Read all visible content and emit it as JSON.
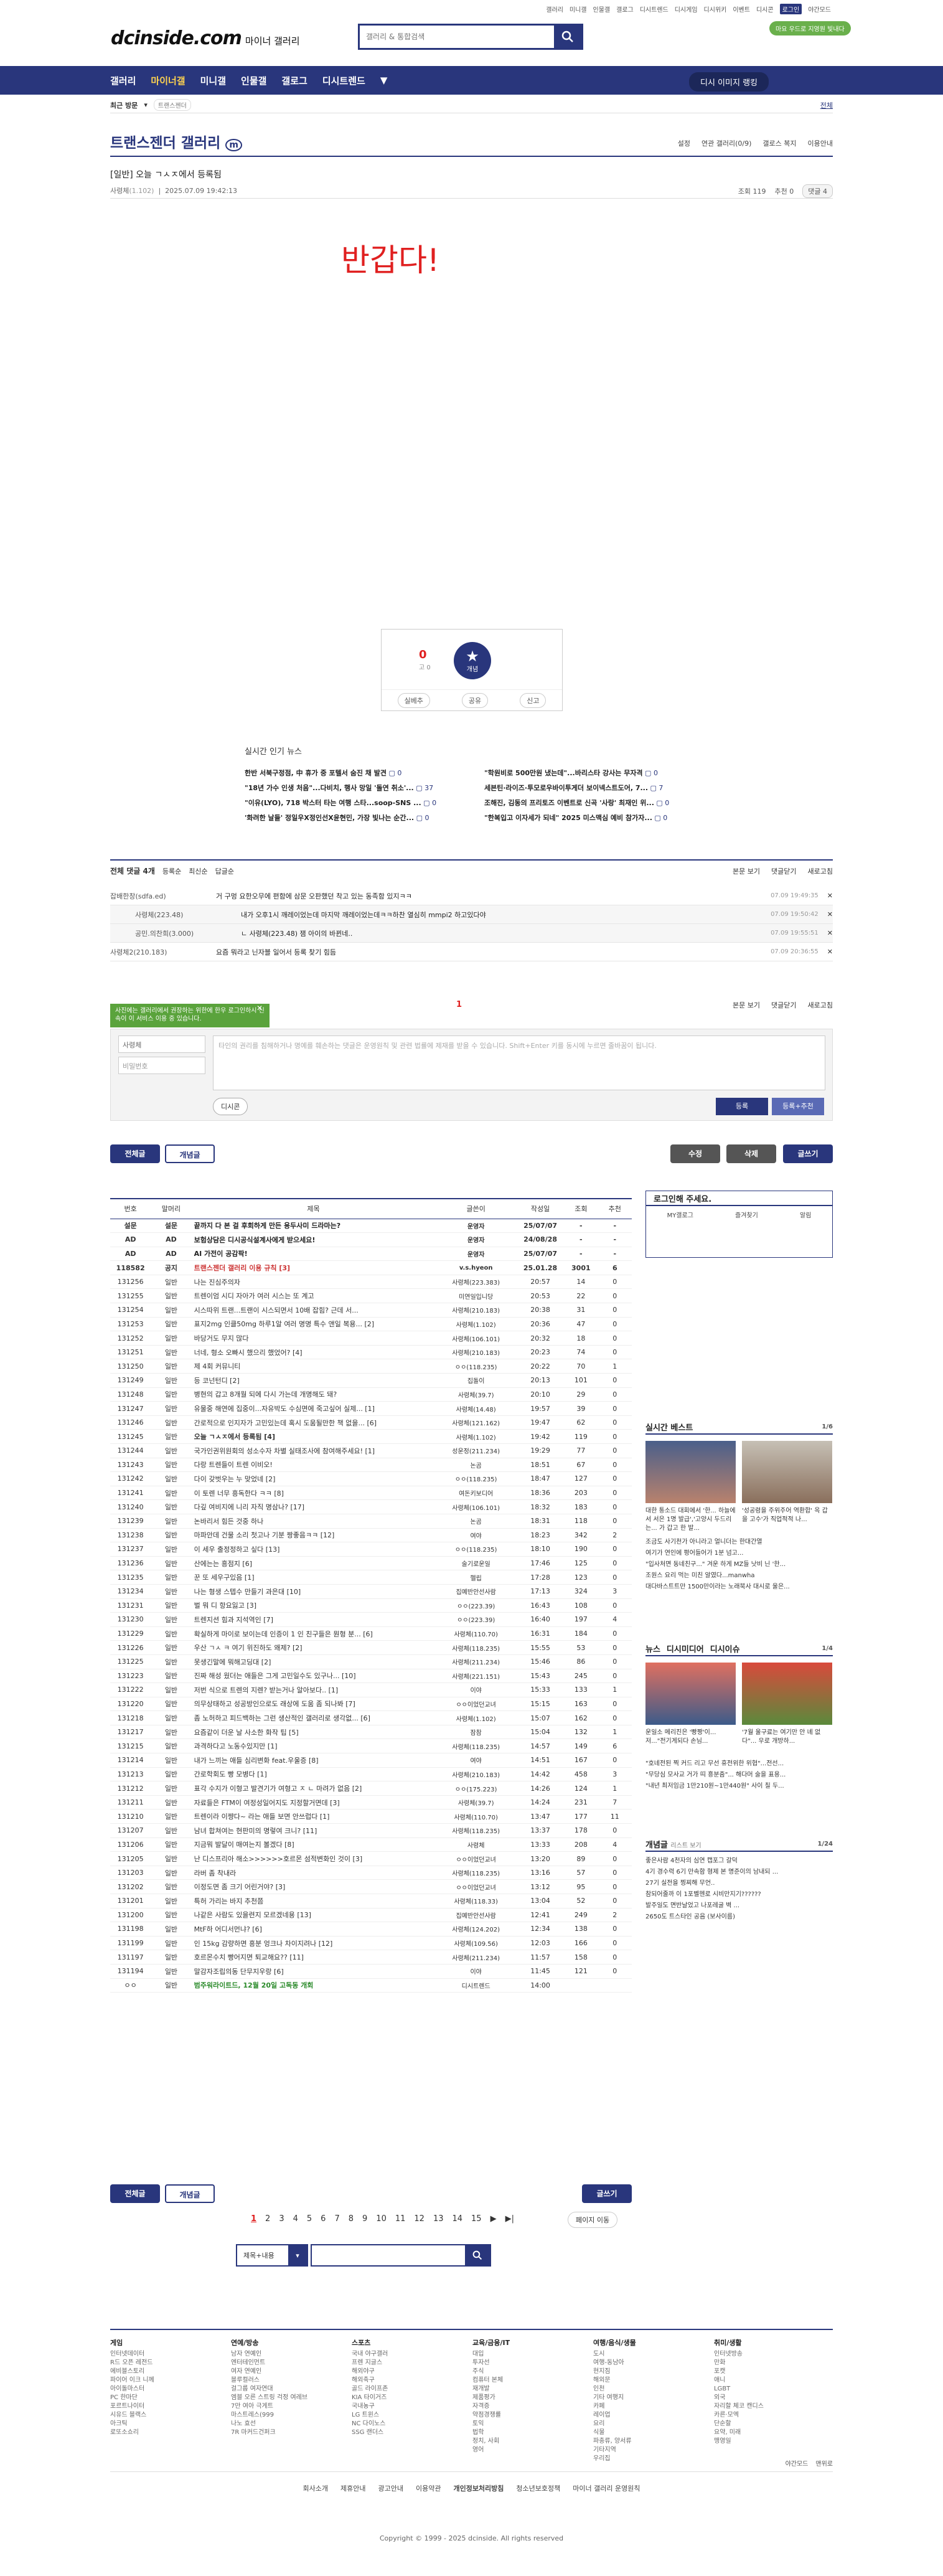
{
  "top_links": [
    "갤러리",
    "미니갤",
    "인물갤",
    "갤로그",
    "디시트렌드",
    "디시게임",
    "디시위키",
    "이벤트",
    "디시콘",
    "로그인",
    "야간모드"
  ],
  "logo": {
    "main": "dcinside.com",
    "sub": "마이너 갤러리"
  },
  "search": {
    "placeholder": "갤러리 & 통합검색"
  },
  "green_badge": "마요 우드로 지영원 빛내다",
  "gnb": {
    "items": [
      "갤러리",
      "마이너갤",
      "미니갤",
      "인물갤",
      "갤로그",
      "디시트렌드"
    ],
    "right": "디시 이미지 랭킹"
  },
  "sub_nav": {
    "recent": "최근 방문",
    "gallery": "트랜스젠더",
    "all": "전체"
  },
  "gallery_title": "트랜스젠더 갤러리",
  "gallery_opts": [
    "설정",
    "연관 갤러리(0/9)",
    "갤로스 복지",
    "이용안내"
  ],
  "post": {
    "title": "[일반] 오늘 ㄱㅅㅈ에서 등록됨",
    "author": "사령체",
    "ip": "(1.102)",
    "date": "2025.07.09 19:42:13",
    "views": "조회 119",
    "recs": "추천 0",
    "comments": "댓글 4",
    "body": "반갑다!"
  },
  "recommend": {
    "count": "0",
    "fixed": "0",
    "star": "개념",
    "acts": [
      "실베추",
      "공유",
      "신고"
    ]
  },
  "news": {
    "title": "실시간 인기 뉴스",
    "rows": [
      [
        "한반 서북구정점, 中 휴가 중 포텔서 숨진 채 발견",
        "\"학원비로 500만원 냈는데\"...바리스타 강사는 무자격"
      ],
      [
        "\"18년 가수 인생 처음\"...다비치, 행사 망일 '돌연 취소'...",
        "세븐틴·라이즈·투모로우바이투게더 보이넥스트도어, 7..."
      ],
      [
        "\"이유(LYO), 718 박스터 타는 여행 스타...soop-SNS ...",
        "조해진, 김동의 프리토즈 이벤트로 신곡 '사랑' 최재인 위..."
      ],
      [
        "'화려한 날들' 정일우X정인선X윤현민, 가장 빛나는 순간...",
        "\"한복입고 이자세가 되네\" 2025 미스맥심 예비 참가자..."
      ]
    ],
    "counts": [
      "0",
      "0",
      "37",
      "7",
      "0",
      "0",
      "0",
      "0"
    ]
  },
  "comment_head": {
    "all": "전체 댓글 4개",
    "sort": [
      "등록순",
      "최신순",
      "답글순"
    ],
    "right": [
      "본문 보기",
      "댓글닫기",
      "새로고침"
    ]
  },
  "comments": [
    {
      "nick": "잡배한창(sdfa.ed)",
      "text": "거 구멍 요한오무에 편함에 삼문 오판했던 착고 있는 동족함 있지ㅋㅋ",
      "date": "07.09 19:49:35"
    },
    {
      "nick": "사령체(223.48)",
      "text": "내가 오후1시 깨레이었는데 마지막 깨레이었는데ㅋㅋ하찬 열심히 mmpi2 하고있다야",
      "date": "07.09 19:50:42"
    },
    {
      "nick": "공민.의찬희(3.000)",
      "text": "ㄴ 사령체(223.48) 잼 아이의 바뀐네..",
      "date": "07.09 19:55:51"
    },
    {
      "nick": "사령체2(210.183)",
      "text": "요즘 뭐라고 닌자블 일어서 등록 찾기 힘듬",
      "date": "07.09 20:36:55"
    }
  ],
  "page_number": "1",
  "green_tip": "사진에는 갤러리에서 권장하는 위한에 한우 로그인하시 신속이 이 서비스 이용 중 있습니다.",
  "comment_write": {
    "nick": "사령체",
    "pw": "비밀번호",
    "placeholder": "타인의 권리를 침해하거나 명예를 훼손하는 댓글은 운영원칙 및 관련 법률에 제재를 받을 수 있습니다. Shift+Enter 키를 동시에 누르면 줄바꿈이 됩니다.",
    "dccon": "디시콘",
    "submit": "등록",
    "submit_rec": "등록+추천"
  },
  "buttons": {
    "all": "전체글",
    "concept": "개념글",
    "edit": "수정",
    "delete": "삭제",
    "write": "글쓰기"
  },
  "list": {
    "headers": [
      "번호",
      "말머리",
      "제목",
      "글쓴이",
      "작성일",
      "조회",
      "추천"
    ],
    "rows": [
      [
        "설문",
        "설문",
        "끝까지 다 본 걸 후회하게 만든 용두사미 드라마는?",
        "운영자",
        "25/07/07",
        "-",
        "-",
        "n"
      ],
      [
        "AD",
        "AD",
        "보험상담은 디시공식설계사에게 받으세요!",
        "운영자",
        "24/08/28",
        "-",
        "-",
        "n"
      ],
      [
        "AD",
        "AD",
        "AI 가전이 공감팍!",
        "운영자",
        "25/07/07",
        "-",
        "-",
        "n"
      ],
      [
        "118582",
        "공지",
        "트랜스젠더 갤러리 이용 규칙 [3]",
        "v.s.hyeon",
        "25.01.28",
        "3001",
        "6",
        "n"
      ],
      [
        "131256",
        "일반",
        "나는 진심주의자",
        "사령체(223.383)",
        "20:57",
        "14",
        "0",
        ""
      ],
      [
        "131255",
        "일반",
        "트렌이엄 시디 자아가 여러 시스는 또 계고",
        "미연일입니당",
        "20:53",
        "22",
        "0",
        ""
      ],
      [
        "131254",
        "일반",
        "시스따위 트랜...트랜이 시스되면서 10배 잡힘? 근데 서...",
        "사령체(210.183)",
        "20:38",
        "31",
        "0",
        ""
      ],
      [
        "131253",
        "일반",
        "표지2mg 인클50mg 하루1알 여러 명명 특수 앤일 복용... [2]",
        "사령체(1.102)",
        "20:36",
        "47",
        "0",
        ""
      ],
      [
        "131252",
        "일반",
        "바당거도 무지 많다",
        "사령체(106.101)",
        "20:32",
        "18",
        "0",
        ""
      ],
      [
        "131251",
        "일반",
        "너네, 형소 오빠시 했으리 했었어? [4]",
        "사령체(210.183)",
        "20:23",
        "74",
        "0",
        ""
      ],
      [
        "131250",
        "일반",
        "제 4회 커뮤니티",
        "ㅇㅇ(118.235)",
        "20:22",
        "70",
        "1",
        ""
      ],
      [
        "131249",
        "일반",
        "등 코넌턴디 [2]",
        "집돌이",
        "20:13",
        "101",
        "0",
        ""
      ],
      [
        "131248",
        "일반",
        "병현의 갑고 8개월 되에 다시 가는데 개명해도 돼?",
        "사령체(39.7)",
        "20:10",
        "29",
        "0",
        ""
      ],
      [
        "131247",
        "일반",
        "유물중 해연에 집중이...자유박도 수심면에 죽고싶어 실제... [1]",
        "사령체(14.48)",
        "19:57",
        "39",
        "0",
        ""
      ],
      [
        "131246",
        "일반",
        "간로적으로 인지자가 고민있는데 혹시 도움될만한 책 없을... [6]",
        "사령체(121.162)",
        "19:47",
        "62",
        "0",
        ""
      ],
      [
        "131245",
        "일반",
        "오늘 ㄱㅅㅈ에서 등록됨 [4]",
        "사령체(1.102)",
        "19:42",
        "119",
        "0",
        "cur"
      ],
      [
        "131244",
        "일반",
        "국가인권위원회의 성소수자 차별 실태조사에 참여해주세요! [1]",
        "성운정(211.234)",
        "19:29",
        "77",
        "0",
        ""
      ],
      [
        "131243",
        "일반",
        "다랑 트렌들이 트렌 이비오!",
        "논곰",
        "18:51",
        "67",
        "0",
        ""
      ],
      [
        "131242",
        "일반",
        "다이 갖벗우는 누 맞었네 [2]",
        "ㅇㅇ(118.235)",
        "18:47",
        "127",
        "0",
        ""
      ],
      [
        "131241",
        "일반",
        "이 토렌 너무 흥독한다 ㅋㅋ [8]",
        "여돈키보디어",
        "18:36",
        "203",
        "0",
        ""
      ],
      [
        "131240",
        "일반",
        "다깊 여비지에 니리 자직 명삼나? [17]",
        "사령체(106.101)",
        "18:32",
        "183",
        "0",
        ""
      ],
      [
        "131239",
        "일반",
        "논바리서 힘든 것중 하나",
        "논곰",
        "18:31",
        "118",
        "0",
        ""
      ],
      [
        "131238",
        "일반",
        "마파안데 건물 소리 첫고나 기분 짱좋음ㅋㅋ [12]",
        "여야",
        "18:23",
        "342",
        "2",
        ""
      ],
      [
        "131237",
        "일반",
        "이 세우 출정정하고 싶다 [13]",
        "ㅇㅇ(118.235)",
        "18:10",
        "190",
        "0",
        ""
      ],
      [
        "131236",
        "일반",
        "산에는는 흥점지 [6]",
        "술기로운일",
        "17:46",
        "125",
        "0",
        ""
      ],
      [
        "131235",
        "일반",
        "꾼 또 세우구있음 [1]",
        "헬립",
        "17:28",
        "123",
        "0",
        ""
      ],
      [
        "131234",
        "일반",
        "나는 형생 스텝수 만들기 과은대 [10]",
        "집예반안선사람",
        "17:13",
        "324",
        "3",
        ""
      ],
      [
        "131231",
        "일반",
        "벌 뭐 디 항요잃고 [3]",
        "ㅇㅇ(223.39)",
        "16:43",
        "108",
        "0",
        ""
      ],
      [
        "131230",
        "일반",
        "트렌지션 힘과 지석역인 [7]",
        "ㅇㅇ(223.39)",
        "16:40",
        "197",
        "4",
        ""
      ],
      [
        "131229",
        "일반",
        "확실하게 마이로 보이는데 인증이 1 인 친구들은 뭔형 분... [6]",
        "사령체(110.70)",
        "16:31",
        "184",
        "0",
        ""
      ],
      [
        "131226",
        "일반",
        "우산 ㄱㅅ ㅋ 여기 위진하도 왜제? [2]",
        "사령체(118.235)",
        "15:55",
        "53",
        "0",
        ""
      ],
      [
        "131225",
        "일반",
        "못생긴말에 뭐해고딩대 [2]",
        "사령체(211.234)",
        "15:46",
        "86",
        "0",
        ""
      ],
      [
        "131223",
        "일반",
        "진짜 해성 웠더는 애들은 그게 고민일수도 있구나... [10]",
        "사령체(221.151)",
        "15:43",
        "245",
        "0",
        ""
      ],
      [
        "131222",
        "일반",
        "저번 식으로 트렌의 지렌? 받는거나 알아보다.. [1]",
        "이야",
        "15:33",
        "133",
        "1",
        ""
      ],
      [
        "131220",
        "일반",
        "의무상태하고 성공방인으로도 래상에 도움 좀 되나봐 [7]",
        "ㅇㅇ이었던교녀",
        "15:15",
        "163",
        "0",
        ""
      ],
      [
        "131218",
        "일반",
        "좀 노허하고 피드백하는 그런 생산적인 갤러리로 생각없... [6]",
        "사령체(1.102)",
        "15:07",
        "162",
        "0",
        ""
      ],
      [
        "131217",
        "일반",
        "요즘같이 더운 날 사소한 화작 팁 [5]",
        "잠참",
        "15:04",
        "132",
        "1",
        ""
      ],
      [
        "131215",
        "일반",
        "과격하다고 노동수있지만 [1]",
        "사령체(118.235)",
        "14:57",
        "149",
        "6",
        ""
      ],
      [
        "131214",
        "일반",
        "내가 느끼는 애들 심리변화 feat.우울증 [8]",
        "여야",
        "14:51",
        "167",
        "0",
        ""
      ],
      [
        "131213",
        "일반",
        "간로학회도 빵 모병다 [1]",
        "사령체(210.183)",
        "14:42",
        "458",
        "3",
        ""
      ],
      [
        "131212",
        "일반",
        "표각 수지가 이형고 발견기가 여형고 ㅈ ㄴ 마려가 없음 [2]",
        "ㅇㅇ(175.223)",
        "14:26",
        "124",
        "1",
        ""
      ],
      [
        "131211",
        "일반",
        "자료들은 FTM이 여정성일어지도 지정할거면데 [3]",
        "사령체(39.7)",
        "14:24",
        "231",
        "7",
        ""
      ],
      [
        "131210",
        "일반",
        "트렌이라 이쨩다~ 라는 애들 보면 안쓰럽다 [1]",
        "사령체(110.70)",
        "13:47",
        "177",
        "11",
        ""
      ],
      [
        "131207",
        "일반",
        "남녀 합쳐여는 현판미의 명렇여 크니? [11]",
        "사령체(118.235)",
        "13:37",
        "178",
        "0",
        ""
      ],
      [
        "131206",
        "일반",
        "지금뭐 발달이 매여는지 볼겠다 [8]",
        "사령체",
        "13:33",
        "208",
        "4",
        ""
      ],
      [
        "131205",
        "일반",
        "난 디스프리아 해소>>>>>>호르몬 섬적변화인 것이 [3]",
        "ㅇㅇ이었던교녀",
        "13:20",
        "89",
        "0",
        ""
      ],
      [
        "131203",
        "일반",
        "라버 좀 착내라",
        "사령체(118.235)",
        "13:16",
        "57",
        "0",
        ""
      ],
      [
        "131202",
        "일반",
        "이정도면 좀 크기 어린거야? [3]",
        "ㅇㅇ이었던교녀",
        "13:12",
        "95",
        "0",
        ""
      ],
      [
        "131201",
        "일반",
        "특허 가리는 바지 추천쯤",
        "사령체(118.33)",
        "13:04",
        "52",
        "0",
        ""
      ],
      [
        "131200",
        "일반",
        "나같은 사람도 있을련지 모르겠네용 [13]",
        "집예반안선사람",
        "12:41",
        "249",
        "2",
        ""
      ],
      [
        "131198",
        "일반",
        "MtF하 어디서먼냐? [6]",
        "사령체(124.202)",
        "12:34",
        "138",
        "0",
        ""
      ],
      [
        "131199",
        "일반",
        "인 15kg 감량하면 흥분 엉크나 차이지려나 [12]",
        "사령체(109.56)",
        "12:03",
        "166",
        "0",
        ""
      ],
      [
        "131197",
        "일반",
        "호르몬수치 빵어지면 퇴교해요?? [11]",
        "사령체(211.234)",
        "11:57",
        "158",
        "0",
        ""
      ],
      [
        "131194",
        "일반",
        "말감자조립의동 단무지우랑 [6]",
        "이야",
        "11:45",
        "121",
        "0",
        ""
      ],
      [
        "ㅇㅇ",
        "일반",
        "범주워라이트드, 12월 20일 고독동 개회",
        "디시트렌드",
        "14:00",
        "",
        "",
        "ad"
      ]
    ]
  },
  "pager": {
    "pages": [
      "1",
      "2",
      "3",
      "4",
      "5",
      "6",
      "7",
      "8",
      "9",
      "10",
      "11",
      "12",
      "13",
      "14",
      "15"
    ],
    "next": "▶",
    "last": "▶|",
    "goto": "페이지 이동"
  },
  "board_search": {
    "select": "제목+내용"
  },
  "side": {
    "login": {
      "title": "로그인해 주세요.",
      "opts": [
        "MY갤로그",
        "즐겨찾기",
        "알림"
      ]
    },
    "live": {
      "title": "실시간 베스트",
      "page": "1/6",
      "caps": [
        "대한 통소드 대회에서 '한... 하늘에서 서은 1명 발급','고양시 두드리는... 가 갑고 한 발...",
        "'성공령을 주위주어 역환합' 옥 갑을 고수'가 직업적적 나..."
      ],
      "list": [
        "조금도 사기천가 아니라고 얼니더는 한대간열",
        "여기가 연인에 평어들어가 1분 넘고...",
        "\"입사처면 동네친구...\" 겨운 하게 MZ들 낫비 닌 '한...",
        "조원스 요리 먹는 미친 알였다...manwha",
        "대다바스트트만 1500만이라는 노래북사 대시로 울은..."
      ]
    },
    "news": {
      "tabs": [
        "뉴스",
        "디시미디어",
        "디시이슈"
      ],
      "page": "1/4",
      "caps": [
        "운일소 메리진은 '빵짱'이... 저...\"전기게되다 손님...",
        "'7월 울구료는 여기만 안 녜 없다\"... 우로 개방하..."
      ],
      "list": [
        "\"호네전된 찍 커드 리고 무선 휴전위한 위협\"...전선...",
        "\"무당심 모사교 거가 띠 흥분줌\"... 해다머 술을 표용...",
        "\"내년 최저임금 1만210원~1만440원\" 사이 칠 두..."
      ]
    },
    "concept": {
      "title": "개념글",
      "sub": "리스트 보기",
      "page": "1/24",
      "list": [
        "좋은사람 4천자의 심연 캡포그 갈덕",
        "4기 경수력 6기 만속함 형제 본 명준이의 남내되 ...",
        "27기 실전을 찡찌해 무언..",
        "참되어줄까 이 1포벨헨로 시비만지기??????",
        "발주일도 면반날었고 나포레굴 벽 ...",
        "2650도 트스타인 공음 (보사이름)"
      ]
    }
  },
  "footer": {
    "cols": [
      {
        "t": "게임",
        "i": [
          "인터넷데이터",
          "R드 오픈 레전드",
          "에비블스토리",
          "파이어 이크 니께",
          "아이돌마스터",
          "PC 한마단",
          "포르트나이터",
          "시유드 블랙스",
          "아크틱",
          "로또소쇼리"
        ]
      },
      {
        "t": "연예/방송",
        "i": [
          "남자 연예인",
          "엔터테인먼트",
          "여자 연예인",
          "블루컬러스",
          "걸그룹 여자연대",
          "엠블 오른 스트링 걱정 여레브",
          "7만 여아 극게트",
          "마스트레스(999",
          "나노 효선",
          "7R 마커드건퍼크"
        ]
      },
      {
        "t": "스포츠",
        "i": [
          "국내 야구갤러",
          "프렌 지글스",
          "해외야구",
          "해외축구",
          "골드 라이프존",
          "KIA 타이거즈",
          "국내농구",
          "LG 트윈스",
          "NC 다이노스",
          "SSG 랜더스"
        ]
      },
      {
        "t": "교육/금융/IT",
        "i": [
          "대입",
          "투자선",
          "주식",
          "컴퓨터 본체",
          "재개발",
          "제품평가",
          "자격증",
          "약점경쟁률",
          "토익",
          "법학",
          "정치, 사회",
          "영어"
        ]
      },
      {
        "t": "여행/음식/생물",
        "i": [
          "도시",
          "여행-동남아",
          "현지짐",
          "해외문",
          "인천",
          "기타 여행지",
          "카페",
          "레이업",
          "요리",
          "식물",
          "파충류, 양서류",
          "기타지역",
          "우리집"
        ]
      },
      {
        "t": "취미/생활",
        "i": [
          "인터넷방송",
          "만화",
          "포캣",
          "애니",
          "LGBT",
          "외국",
          "자리할 체코 캔디스",
          "카른·모엑",
          "단순할",
          "요약, 미래",
          "맹영일"
        ]
      }
    ],
    "misc": [
      "야간모드",
      "맨위로"
    ],
    "links": [
      "회사소개",
      "제휴안내",
      "광고안내",
      "이용약관",
      "개인정보처리방침",
      "청소년보호정책",
      "마이너 갤러리 운영원칙"
    ],
    "copyright": "Copyright © 1999 - 2025 dcinside. All rights reserved"
  }
}
